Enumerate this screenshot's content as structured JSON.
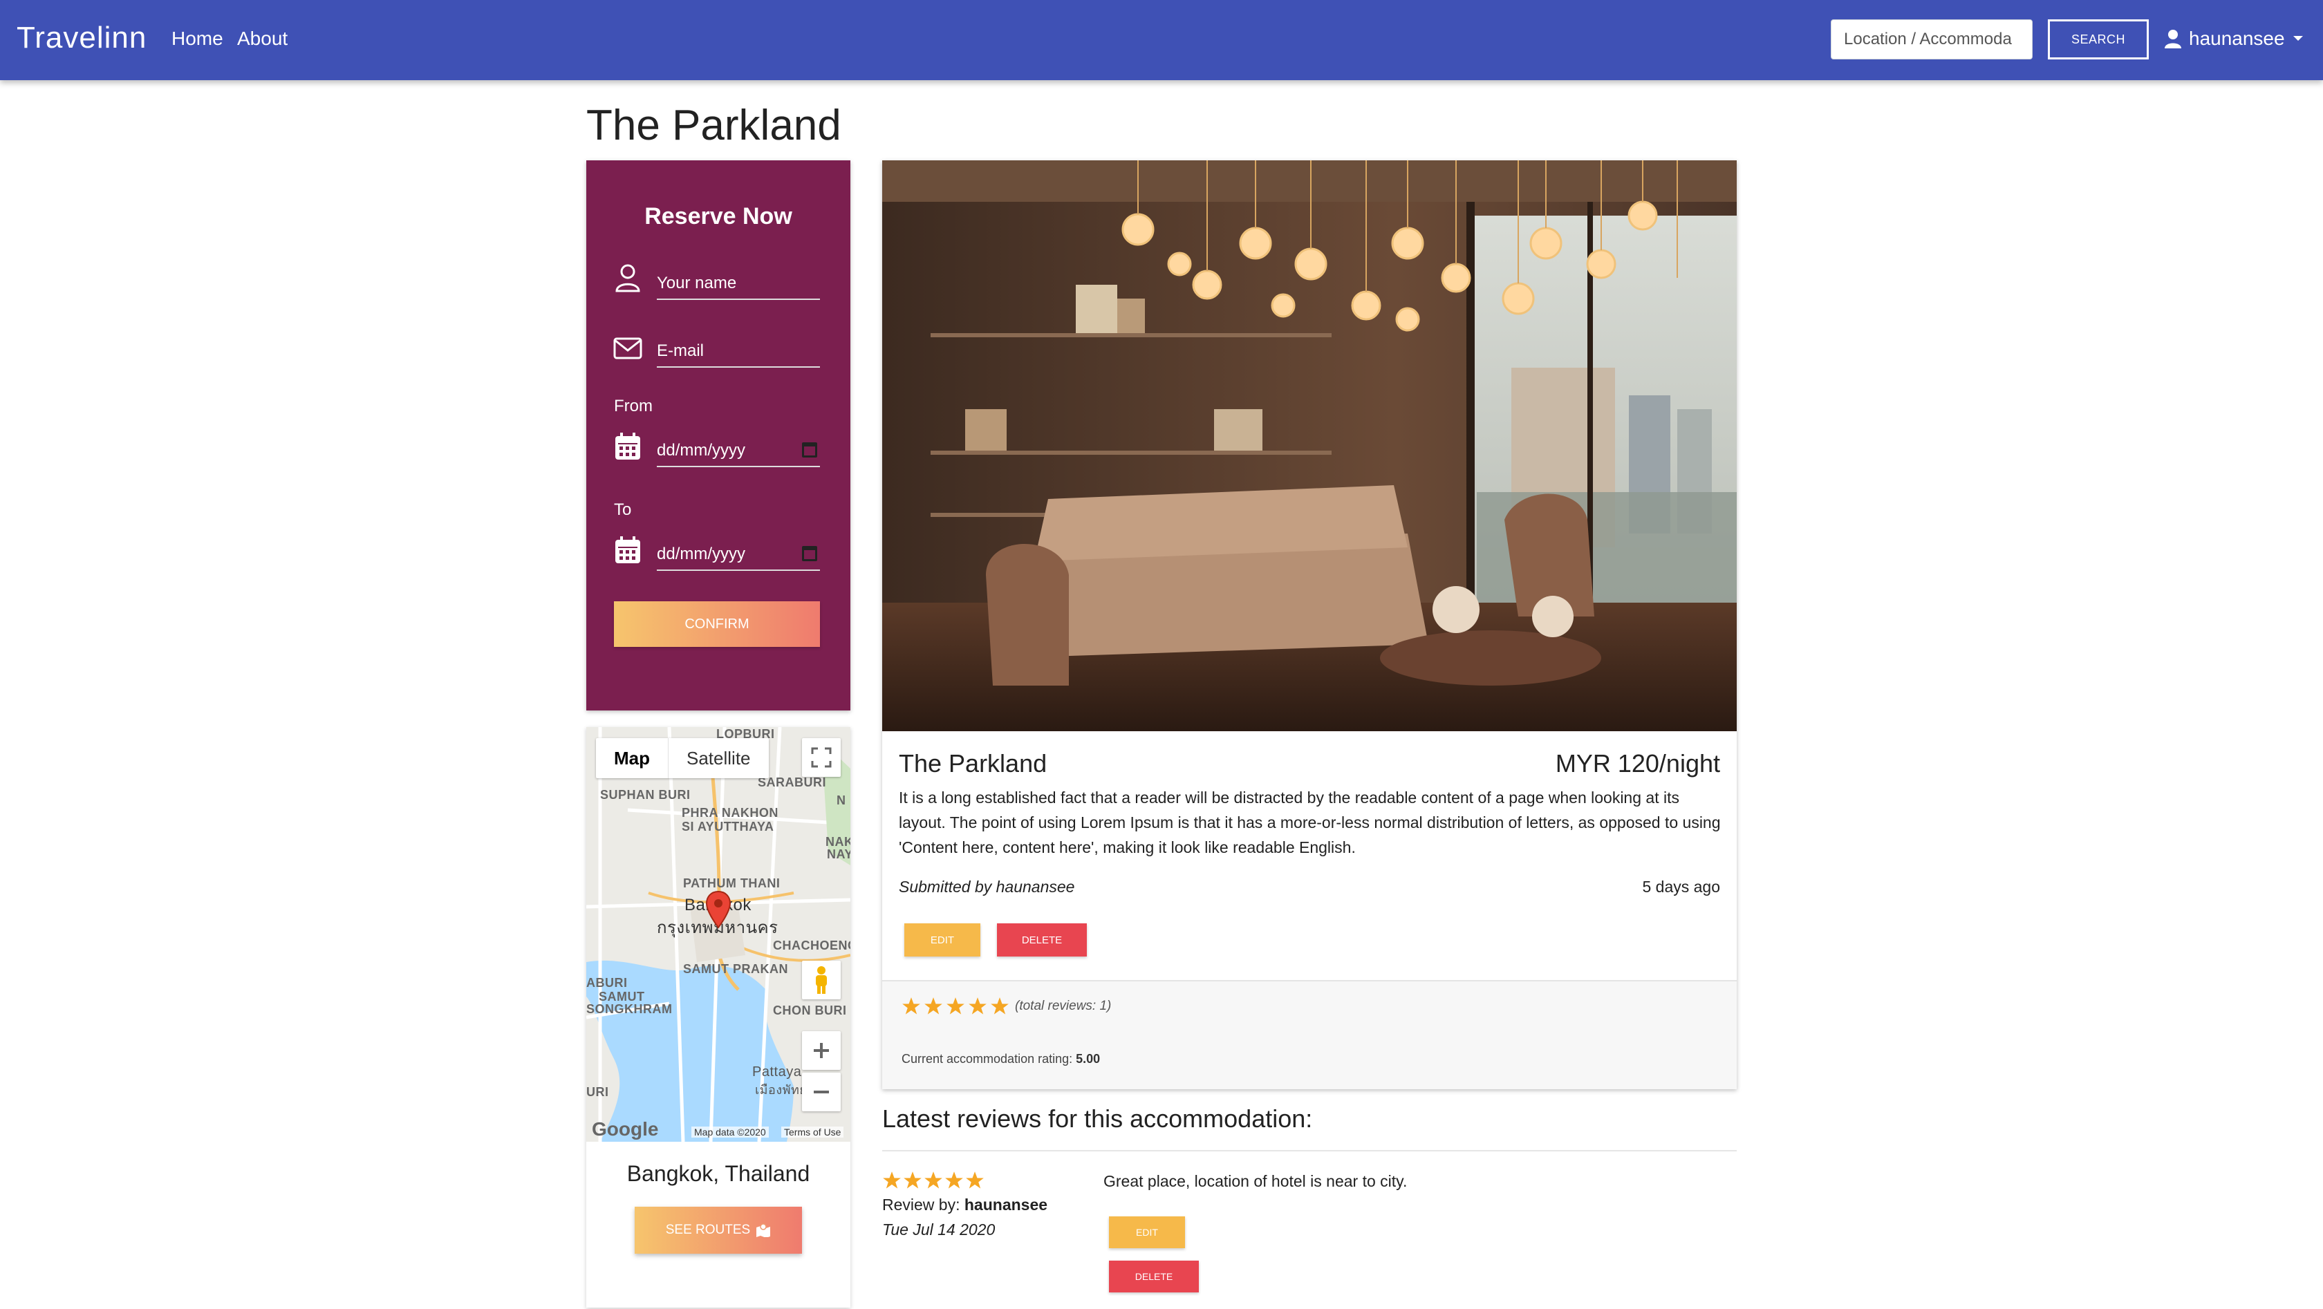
{
  "navbar": {
    "brand": "Travelinn",
    "links": [
      "Home",
      "About"
    ],
    "search_value": "Location / Accommoda",
    "search_button": "SEARCH",
    "username": "haunansee"
  },
  "page_title": "The Parkland",
  "reserve": {
    "title": "Reserve Now",
    "name_placeholder": "Your name",
    "email_placeholder": "E-mail",
    "from_label": "From",
    "from_value": "dd/mm/yyyy",
    "to_label": "To",
    "to_value": "dd/mm/yyyy",
    "confirm": "CONFIRM"
  },
  "map": {
    "tab_map": "Map",
    "tab_satellite": "Satellite",
    "labels": {
      "lopburi": "LOPBURI",
      "saraburi": "SARABURI",
      "suphan_buri": "SUPHAN BURI",
      "phra_nakhon_1": "PHRA NAKHON",
      "phra_nakhon_2": "SI AYUTTHAYA",
      "nak": "NAK",
      "nay": "NAY",
      "pathum_thani": "PATHUM THANI",
      "bangkok": "Bangkok",
      "bangkok_thai": "กรุงเทพมหานคร",
      "chachoeng": "CHACHOENG",
      "samut_prakan": "SAMUT PRAKAN",
      "aburi": "ABURI",
      "samut": "SAMUT",
      "songkhram": "SONGKHRAM",
      "chon_buri": "CHON BURI",
      "pattaya": "Pattaya",
      "pattaya_thai": "เมืองพัทยา",
      "uri": "URI",
      "n": "N"
    },
    "attribution_logo": "Google",
    "attribution_data": "Map data ©2020",
    "attribution_terms": "Terms of Use",
    "city": "Bangkok, Thailand",
    "routes_button": "SEE ROUTES"
  },
  "listing": {
    "name": "The Parkland",
    "price": "MYR 120/night",
    "description": "It is a long established fact that a reader will be distracted by the readable content of a page when looking at its layout. The point of using Lorem Ipsum is that it has a more-or-less normal distribution of letters, as opposed to using 'Content here, content here', making it look like readable English.",
    "submitted_by": "Submitted by haunansee",
    "age": "5 days ago",
    "edit": "EDIT",
    "delete": "DELETE",
    "star_count": 5,
    "total_reviews": "(total reviews: 1)",
    "rating_label": "Current accommodation rating:",
    "rating_value": "5.00"
  },
  "reviews": {
    "heading": "Latest reviews for this accommodation:",
    "items": [
      {
        "stars": 5,
        "by_label": "Review by:",
        "author": "haunansee",
        "date": "Tue Jul 14 2020",
        "text": "Great place, location of hotel is near to city.",
        "edit": "EDIT",
        "delete": "DELETE"
      }
    ]
  },
  "colors": {
    "navbar": "#3f51b5",
    "reserve_bg": "#7b1f4f",
    "gradient_start": "#f6c56d",
    "gradient_end": "#ef7b6e",
    "edit": "#f6b94a",
    "delete": "#e84550",
    "star": "#f5a623"
  }
}
